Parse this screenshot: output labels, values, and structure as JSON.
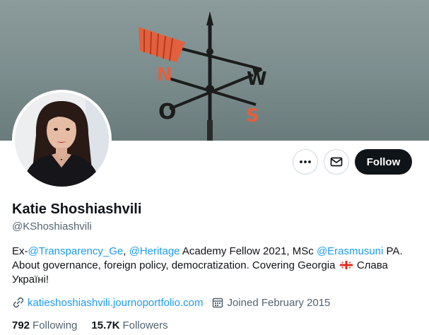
{
  "profile": {
    "name": "Katie Shoshiashvili",
    "handle": "@KShoshiashvili",
    "bio": {
      "prefix": "Ex-",
      "mention1": "@Transparency_Ge",
      "sep1": ", ",
      "mention2": "@Heritage",
      "mid": " Academy Fellow 2021, MSc ",
      "mention3": "@Erasmusuni",
      "line_rest": " PA. About governance, foreign policy, democratization. Covering Georgia",
      "suffix": " Слава Україні!"
    },
    "website": "katieshoshiashvili.journoportfolio.com",
    "joined": "Joined February 2015",
    "following_count": "792",
    "following_label": "Following",
    "followers_count": "15.7K",
    "followers_label": "Followers"
  },
  "actions": {
    "follow_label": "Follow"
  },
  "icons": {
    "more": "more-icon",
    "message": "envelope-icon",
    "link": "link-icon",
    "calendar": "calendar-icon",
    "flag": "georgia-flag-icon"
  },
  "colors": {
    "accent": "#1d9bf0",
    "text": "#0f1419",
    "muted": "#536471",
    "follow_bg": "#0f1419"
  }
}
